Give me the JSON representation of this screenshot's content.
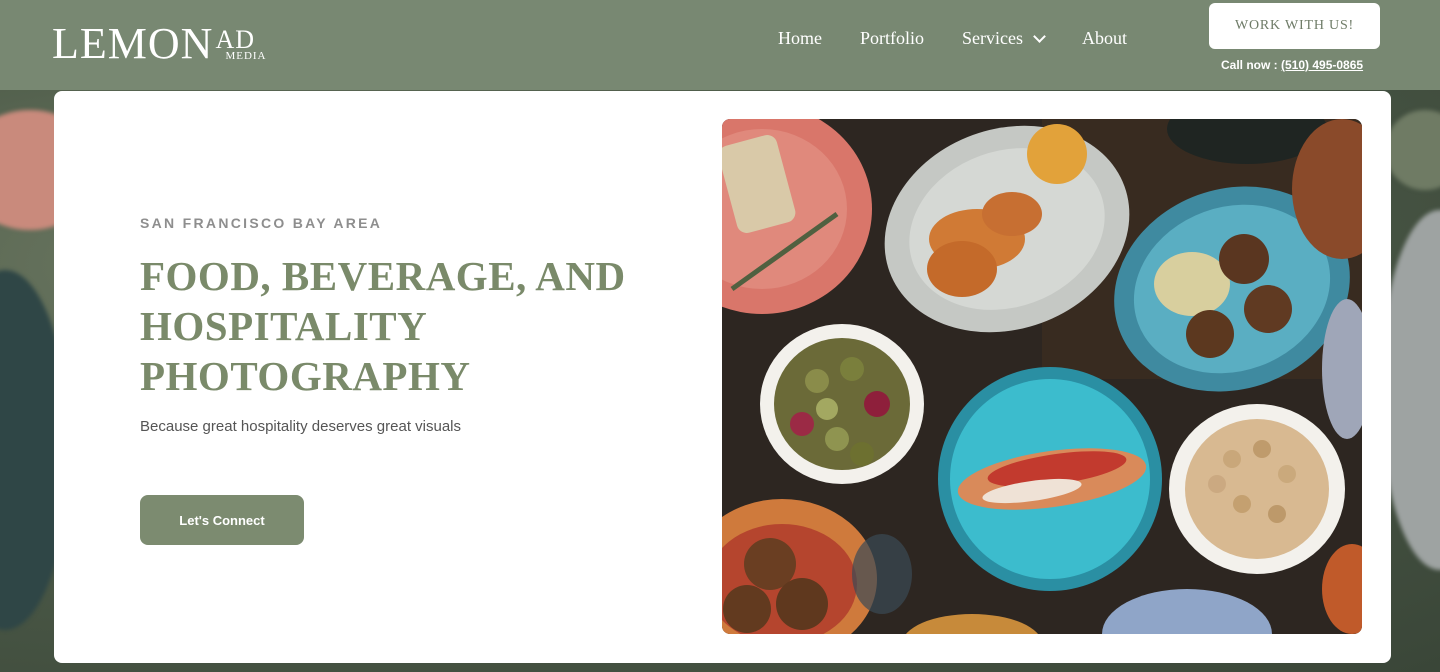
{
  "header": {
    "logo": {
      "main": "LEMON",
      "ad": "AD",
      "media": "MEDIA"
    },
    "nav": [
      {
        "label": "Home"
      },
      {
        "label": "Portfolio"
      },
      {
        "label": "Services"
      },
      {
        "label": "About"
      }
    ],
    "cta_label": "WORK WITH US!",
    "call_prefix": "Call now :",
    "phone": "(510) 495-0865"
  },
  "hero": {
    "eyebrow": "SAN FRANCISCO BAY AREA",
    "headline_lines": [
      "FOOD, BEVERAGE, AND",
      "HOSPITALITY",
      "PHOTOGRAPHY"
    ],
    "tagline": "Because great hospitality deserves great visuals",
    "button_label": "Let's Connect"
  },
  "colors": {
    "header_bg": "#788872",
    "accent_green": "#7a8a6a",
    "button_green": "#7c8b70"
  },
  "icons": {
    "services_dropdown": "chevron-down-icon"
  }
}
